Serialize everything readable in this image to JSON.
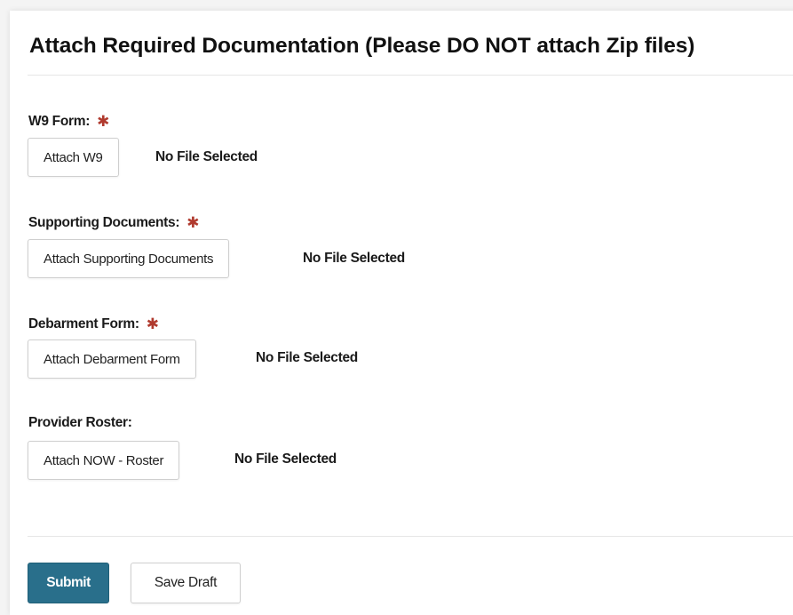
{
  "form": {
    "heading": "Attach Required Documentation (Please DO NOT attach Zip files)",
    "required_marker": "✱",
    "fields": [
      {
        "label": "W9 Form:",
        "required": true,
        "button_label": "Attach W9",
        "status": "No File Selected"
      },
      {
        "label": "Supporting Documents:",
        "required": true,
        "button_label": "Attach Supporting Documents",
        "status": "No File Selected"
      },
      {
        "label": "Debarment Form:",
        "required": true,
        "button_label": "Attach Debarment Form",
        "status": "No File Selected"
      },
      {
        "label": "Provider Roster:",
        "required": false,
        "button_label": "Attach NOW - Roster",
        "status": "No File Selected"
      }
    ],
    "actions": {
      "submit_label": "Submit",
      "save_draft_label": "Save Draft"
    }
  },
  "colors": {
    "accent": "#296f8b",
    "required": "#b03a2e"
  }
}
